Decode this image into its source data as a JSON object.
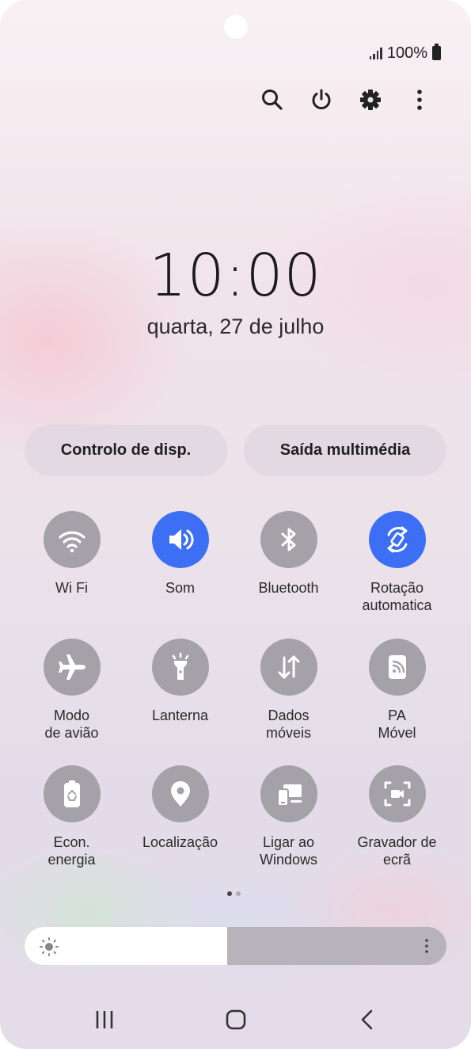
{
  "status_bar": {
    "battery": "100%"
  },
  "clock": {
    "time": "10:00",
    "date": "quarta, 27 de julho"
  },
  "pills": {
    "device_control": "Controlo de disp.",
    "media_output": "Saída multimédia"
  },
  "tiles": [
    {
      "label": "Wi Fi",
      "icon": "wifi-icon",
      "active": false
    },
    {
      "label": "Som",
      "icon": "sound-icon",
      "active": true
    },
    {
      "label": "Bluetooth",
      "icon": "bluetooth-icon",
      "active": false
    },
    {
      "label": "Rotação\nautomatica",
      "icon": "auto-rotate-icon",
      "active": true
    },
    {
      "label": "Modo\nde avião",
      "icon": "airplane-icon",
      "active": false
    },
    {
      "label": "Lanterna",
      "icon": "flashlight-icon",
      "active": false
    },
    {
      "label": "Dados\nmóveis",
      "icon": "mobile-data-icon",
      "active": false
    },
    {
      "label": "PA\nMóvel",
      "icon": "hotspot-icon",
      "active": false
    },
    {
      "label": "Econ.\nenergia",
      "icon": "power-saving-icon",
      "active": false
    },
    {
      "label": "Localização",
      "icon": "location-icon",
      "active": false
    },
    {
      "label": "Ligar ao\nWindows",
      "icon": "link-to-windows-icon",
      "active": false
    },
    {
      "label": "Gravador de\necrã",
      "icon": "screen-recorder-icon",
      "active": false
    }
  ],
  "page_indicator": {
    "pages": 2,
    "current": 1
  },
  "brightness": {
    "level": 0.48
  },
  "colors": {
    "accent": "#3d6ff4",
    "tile_off": "#a4a1a9",
    "text": "#2a2a2a"
  }
}
